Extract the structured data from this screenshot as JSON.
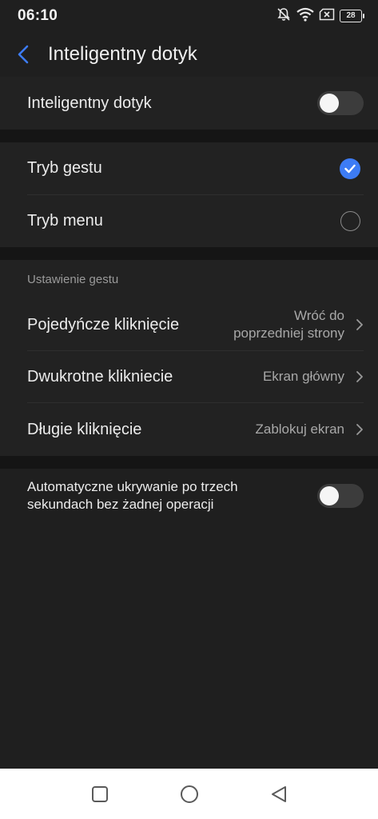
{
  "status_bar": {
    "time": "06:10",
    "battery": "28"
  },
  "header": {
    "title": "Inteligentny dotyk"
  },
  "main_toggle": {
    "label": "Inteligentny dotyk",
    "enabled": false
  },
  "mode": {
    "options": [
      {
        "label": "Tryb gestu",
        "selected": true
      },
      {
        "label": "Tryb menu",
        "selected": false
      }
    ]
  },
  "gesture_settings": {
    "section_title": "Ustawienie gestu",
    "items": [
      {
        "label": "Pojedyńcze kliknięcie",
        "value_line1": "Wróć do",
        "value_line2": "poprzedniej strony"
      },
      {
        "label": "Dwukrotne klikniecie",
        "value": "Ekran główny"
      },
      {
        "label": "Długie kliknięcie",
        "value": "Zablokuj ekran"
      }
    ]
  },
  "auto_hide": {
    "label_line1": "Automatyczne ukrywanie po trzech",
    "label_line2": "sekundach bez żadnej operacji",
    "enabled": false
  },
  "colors": {
    "accent": "#3d7cf5",
    "background": "#1f1f1f",
    "nav_bar": "#ffffff"
  },
  "icons": {
    "status": [
      "mute-bell-icon",
      "wifi-icon",
      "no-sim-icon",
      "battery-icon"
    ],
    "navigation": [
      "recents-square-icon",
      "home-circle-icon",
      "back-triangle-icon"
    ]
  }
}
